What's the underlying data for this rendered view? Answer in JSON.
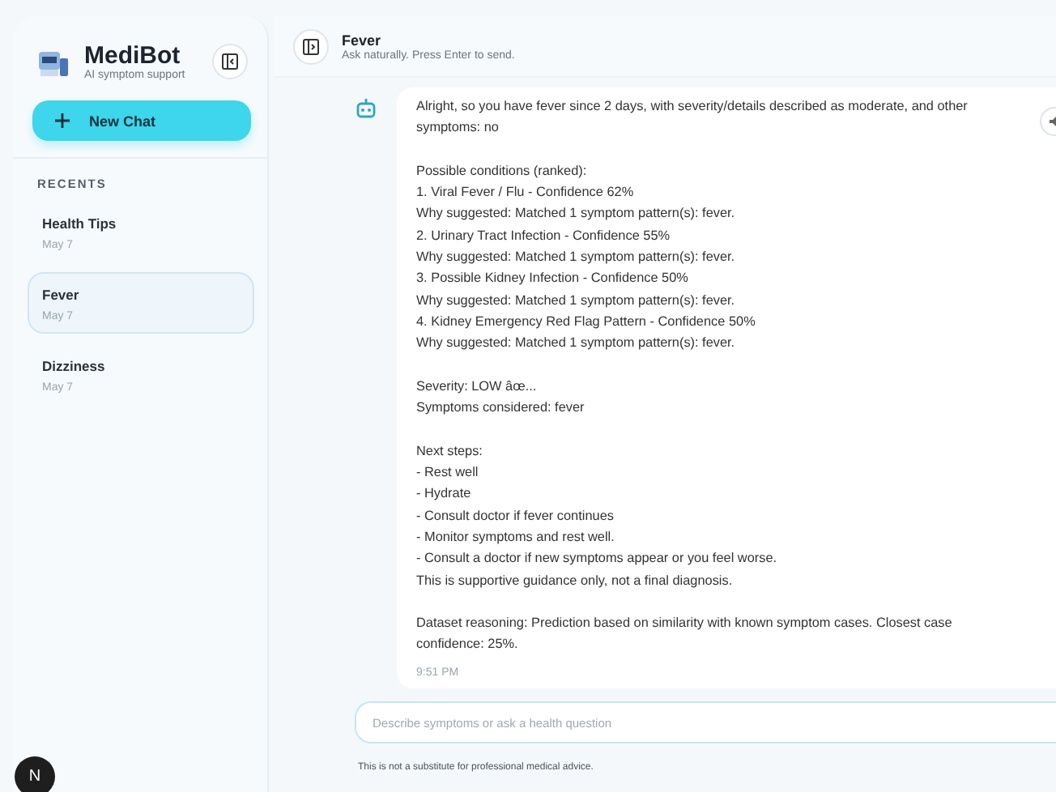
{
  "sidebar": {
    "app_name": "MediBot",
    "tagline": "AI symptom support",
    "new_chat": "New Chat",
    "recents_label": "RECENTS",
    "chats": [
      {
        "title": "Health Tips",
        "date": "May 7",
        "selected": false
      },
      {
        "title": "Fever",
        "date": "May 7",
        "selected": true
      },
      {
        "title": "Dizziness",
        "date": "May 7",
        "selected": false
      }
    ]
  },
  "header": {
    "title": "Fever",
    "subtitle": "Ask naturally. Press Enter to send."
  },
  "message": {
    "paragraphs": [
      [
        "Alright, so you have fever since 2 days, with severity/details described as moderate, and other symptoms: no"
      ],
      [
        "Possible conditions (ranked):",
        "1. Viral Fever / Flu - Confidence 62%",
        "Why suggested: Matched 1 symptom pattern(s): fever.",
        "2. Urinary Tract Infection - Confidence 55%",
        "Why suggested: Matched 1 symptom pattern(s): fever.",
        "3. Possible Kidney Infection - Confidence 50%",
        "Why suggested: Matched 1 symptom pattern(s): fever.",
        "4. Kidney Emergency Red Flag Pattern - Confidence 50%",
        "Why suggested: Matched 1 symptom pattern(s): fever."
      ],
      [
        "Severity: LOW âœ...",
        "Symptoms considered: fever"
      ],
      [
        "Next steps:",
        "- Rest well",
        "- Hydrate",
        "- Consult doctor if fever continues",
        "- Monitor symptoms and rest well.",
        "- Consult a doctor if new symptoms appear or you feel worse.",
        "This is supportive guidance only, not a final diagnosis."
      ],
      [
        "Dataset reasoning: Prediction based on similarity with known symptom cases. Closest case confidence: 25%."
      ]
    ],
    "time": "9:51 PM"
  },
  "composer": {
    "placeholder": "Describe symptoms or ask a health question"
  },
  "disclaimer": "This is not a substitute for professional medical advice.",
  "dev_badge": "N"
}
